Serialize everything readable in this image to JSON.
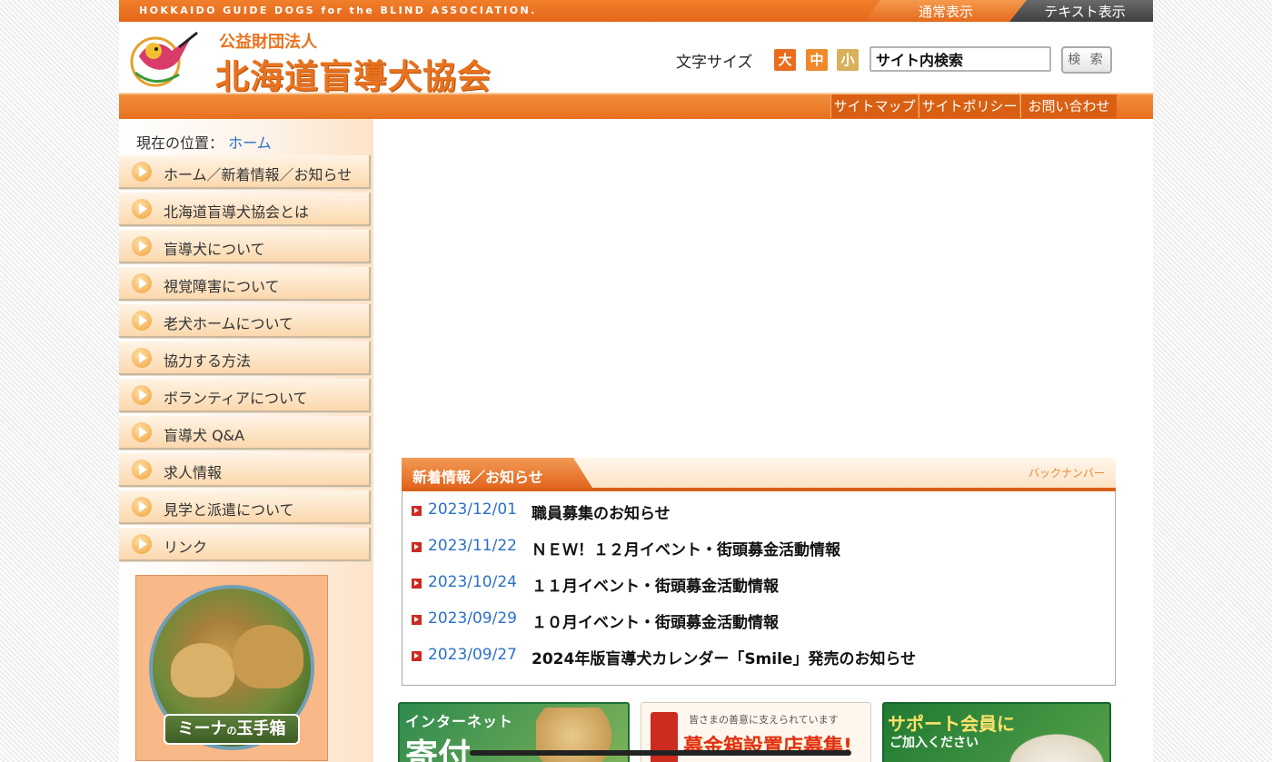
{
  "top_strip": {
    "english_name": "HOKKAIDO GUIDE DOGS for the BLIND ASSOCIATION.",
    "normal_view": "通常表示",
    "text_view": "テキスト表示"
  },
  "header": {
    "org_type": "公益財団法人",
    "org_name": "北海道盲導犬協会",
    "font_size_label": "文字サイズ",
    "font_large": "大",
    "font_medium": "中",
    "font_small": "小",
    "search_value": "サイト内検索",
    "search_button": "検 索"
  },
  "nav": {
    "sitemap": "サイトマップ",
    "policy": "サイトポリシー",
    "contact": "お問い合わせ"
  },
  "breadcrumb": {
    "label": "現在の位置：",
    "home": "ホーム"
  },
  "menu": [
    "ホーム／新着情報／お知らせ",
    "北海道盲導犬協会とは",
    "盲導犬について",
    "視覚障害について",
    "老犬ホームについて",
    "協力する方法",
    "ボランティアについて",
    "盲導犬 Q&A",
    "求人情報",
    "見学と派遣について",
    "リンク"
  ],
  "mina": {
    "banner_title": "ミーナ",
    "banner_suffix": "の",
    "banner_tail": "玉手箱"
  },
  "news": {
    "heading": "新着情報／お知らせ",
    "back_number": "バックナンバー",
    "items": [
      {
        "date": "2023/12/01",
        "title": "職員募集のお知らせ"
      },
      {
        "date": "2023/11/22",
        "title": "ＮＥＷ！１２月イベント・街頭募金活動情報"
      },
      {
        "date": "2023/10/24",
        "title": "１１月イベント・街頭募金活動情報"
      },
      {
        "date": "2023/09/29",
        "title": "１０月イベント・街頭募金活動情報"
      },
      {
        "date": "2023/09/27",
        "title": "2024年版盲導犬カレンダー「Smile」発売のお知らせ"
      }
    ]
  },
  "banners": {
    "donate_line1": "インターネット",
    "donate_line2": "寄付",
    "collect_line1": "皆さまの善意に支えられています",
    "collect_line2": "募金箱設置店募集!",
    "support_line1": "サポート会員に",
    "support_line2": "ご加入ください"
  },
  "colors": {
    "brand_orange": "#e8731f",
    "link_blue": "#2a6fc9",
    "bullet_red": "#cc2a22"
  }
}
